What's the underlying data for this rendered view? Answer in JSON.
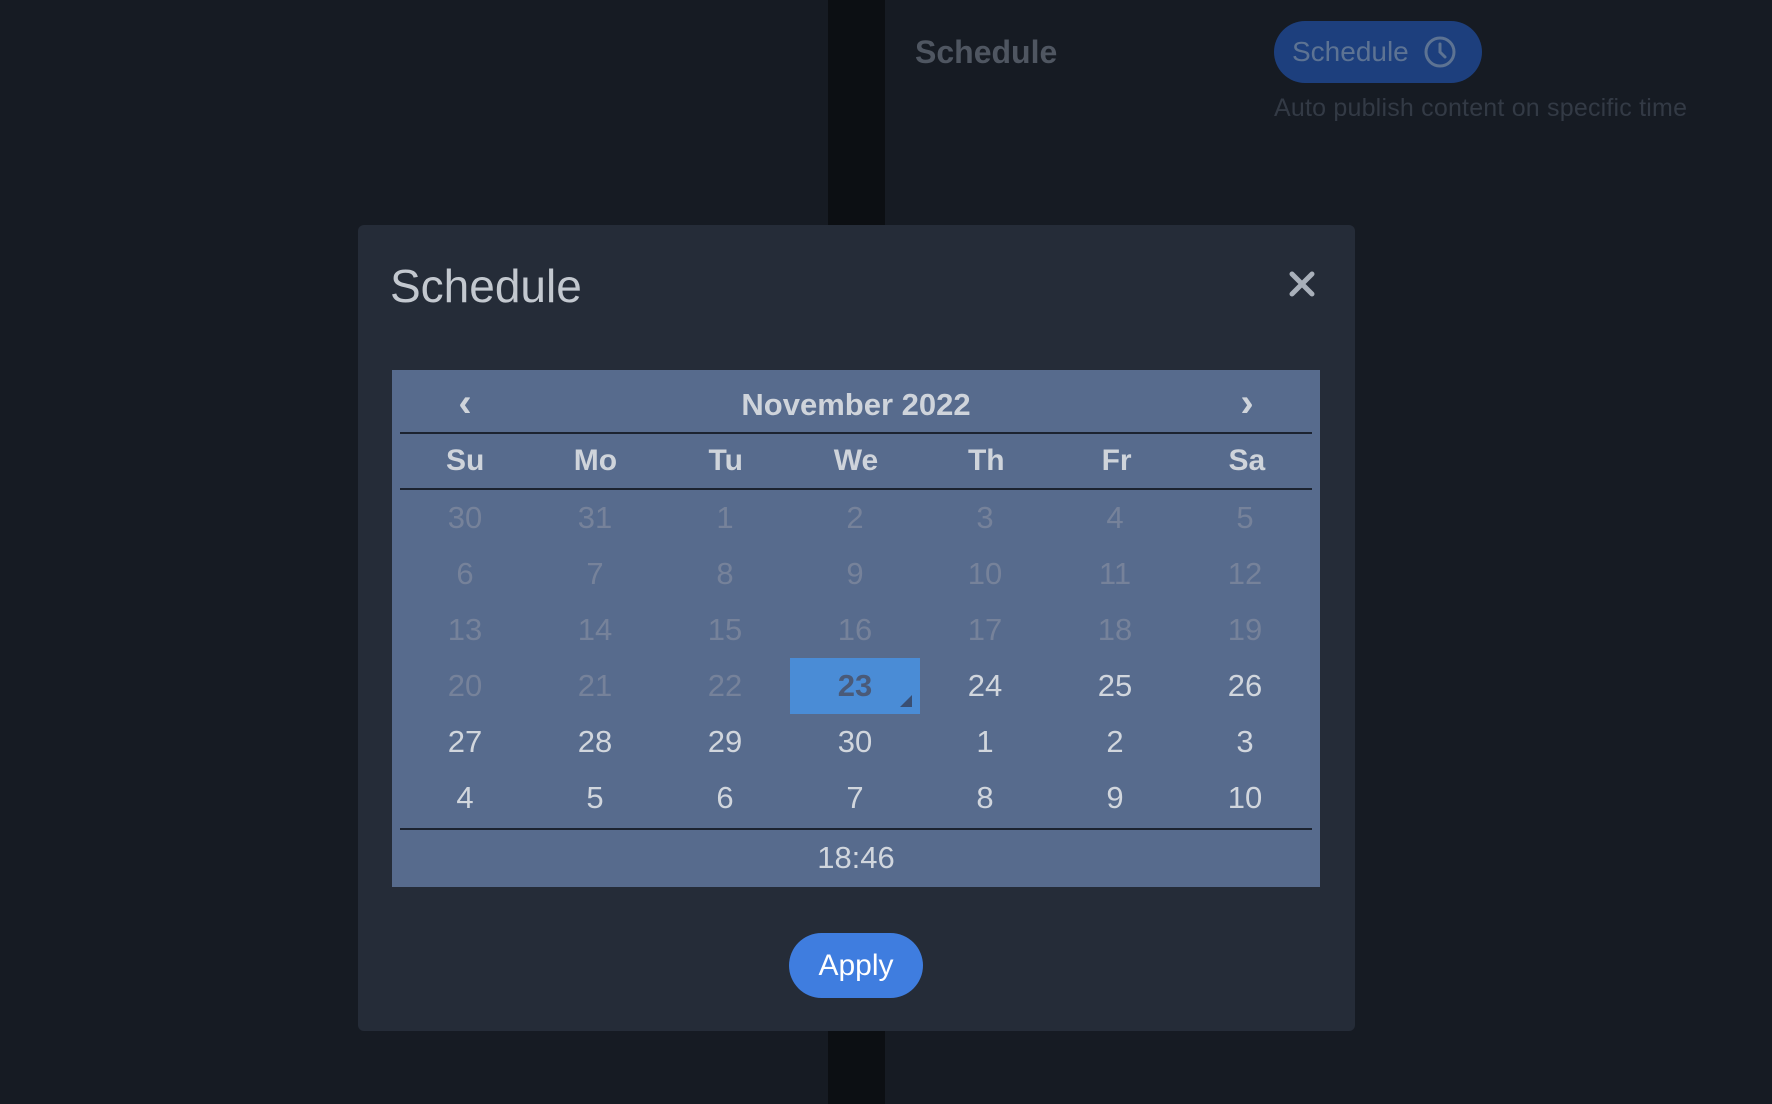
{
  "background": {
    "section_label": "Schedule",
    "schedule_button_label": "Schedule",
    "schedule_button_icon": "clock-icon",
    "help_text": "Auto publish content on specific time"
  },
  "modal": {
    "title": "Schedule",
    "close_icon": "close-icon",
    "apply_label": "Apply"
  },
  "calendar": {
    "prev_label": "‹",
    "next_label": "›",
    "month_label": "November 2022",
    "weekdays": [
      "Su",
      "Mo",
      "Tu",
      "We",
      "Th",
      "Fr",
      "Sa"
    ],
    "weeks": [
      [
        {
          "d": "30",
          "muted": true
        },
        {
          "d": "31",
          "muted": true
        },
        {
          "d": "1",
          "muted": true
        },
        {
          "d": "2",
          "muted": true
        },
        {
          "d": "3",
          "muted": true
        },
        {
          "d": "4",
          "muted": true
        },
        {
          "d": "5",
          "muted": true
        }
      ],
      [
        {
          "d": "6",
          "muted": true
        },
        {
          "d": "7",
          "muted": true
        },
        {
          "d": "8",
          "muted": true
        },
        {
          "d": "9",
          "muted": true
        },
        {
          "d": "10",
          "muted": true
        },
        {
          "d": "11",
          "muted": true
        },
        {
          "d": "12",
          "muted": true
        }
      ],
      [
        {
          "d": "13",
          "muted": true
        },
        {
          "d": "14",
          "muted": true
        },
        {
          "d": "15",
          "muted": true
        },
        {
          "d": "16",
          "muted": true
        },
        {
          "d": "17",
          "muted": true
        },
        {
          "d": "18",
          "muted": true
        },
        {
          "d": "19",
          "muted": true
        }
      ],
      [
        {
          "d": "20",
          "muted": true
        },
        {
          "d": "21",
          "muted": true
        },
        {
          "d": "22",
          "muted": true
        },
        {
          "d": "23",
          "selected": true
        },
        {
          "d": "24"
        },
        {
          "d": "25"
        },
        {
          "d": "26"
        }
      ],
      [
        {
          "d": "27"
        },
        {
          "d": "28"
        },
        {
          "d": "29"
        },
        {
          "d": "30"
        },
        {
          "d": "1"
        },
        {
          "d": "2"
        },
        {
          "d": "3"
        }
      ],
      [
        {
          "d": "4"
        },
        {
          "d": "5"
        },
        {
          "d": "6"
        },
        {
          "d": "7"
        },
        {
          "d": "8"
        },
        {
          "d": "9"
        },
        {
          "d": "10"
        }
      ]
    ],
    "time": "18:46"
  },
  "colors": {
    "page_background": "#161b23",
    "modal_background": "#252c38",
    "calendar_background": "#576b8d",
    "selected_day": "#4a8cd6",
    "accent": "#3f7ddf"
  }
}
